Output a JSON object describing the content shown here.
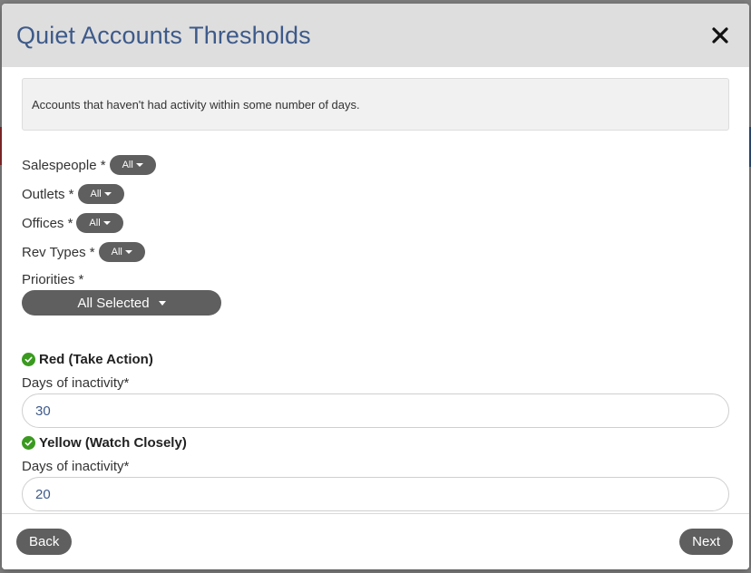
{
  "modal": {
    "title": "Quiet Accounts Thresholds",
    "close_symbol": "✕",
    "description": "Accounts that haven't had activity within some number of days."
  },
  "filters": [
    {
      "label": "Salespeople *",
      "value": "All"
    },
    {
      "label": "Outlets *",
      "value": "All"
    },
    {
      "label": "Offices *",
      "value": "All"
    },
    {
      "label": "Rev Types *",
      "value": "All"
    }
  ],
  "priorities": {
    "label": "Priorities *",
    "value": "All Selected"
  },
  "thresholds": [
    {
      "title": "Red (Take Action)",
      "field_label": "Days of inactivity*",
      "value": "30"
    },
    {
      "title": "Yellow (Watch Closely)",
      "field_label": "Days of inactivity*",
      "value": "20"
    }
  ],
  "footer": {
    "back_label": "Back",
    "next_label": "Next"
  },
  "icons": {
    "close": "close-icon",
    "check": "check-circle-icon",
    "caret": "caret-down-icon"
  },
  "colors": {
    "title": "#3d5a8a",
    "pill": "#5f5f5f",
    "check": "#3a9a1f",
    "header_bg": "#dedede"
  }
}
